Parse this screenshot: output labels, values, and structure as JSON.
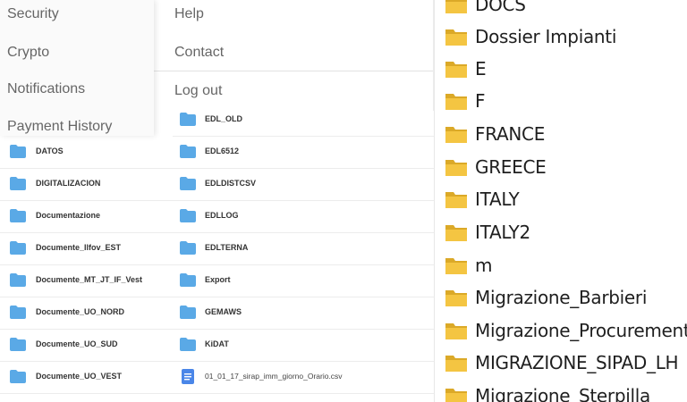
{
  "settings_menu": {
    "items": [
      "Security",
      "Crypto",
      "Notifications",
      "Payment History"
    ]
  },
  "account_menu": {
    "items": [
      "Help",
      "Contact"
    ],
    "logout": "Log out"
  },
  "folder_list_left": {
    "items": [
      "DATOS",
      "DIGITALIZACION",
      "Documentazione",
      "Documente_Ilfov_EST",
      "Documente_MT_JT_IF_Vest",
      "Documente_UO_NORD",
      "Documente_UO_SUD",
      "Documente_UO_VEST"
    ]
  },
  "folder_list_mid": {
    "items": [
      "EDL_OLD",
      "EDL6512",
      "EDLDISTCSV",
      "EDLLOG",
      "EDLTERNA",
      "Export",
      "GEMAWS",
      "KiDAT"
    ],
    "file": "01_01_17_sirap_imm_giorno_Orario.csv"
  },
  "explorer": {
    "folders": [
      "DOCS",
      "Dossier Impianti",
      "E",
      "F",
      "FRANCE",
      "GREECE",
      "ITALY",
      "ITALY2",
      "m",
      "Migrazione_Barbieri",
      "Migrazione_Procurement",
      "MIGRAZIONE_SIPAD_LH",
      "Migrazione_Sterpilla"
    ]
  },
  "colors": {
    "web_folder": "#5aa9e6",
    "file_icon": "#4a86e8",
    "explorer_folder": "#f4c542",
    "explorer_folder_dark": "#dba928",
    "menu_text": "#666666"
  },
  "icons": {
    "web_folder": "folder-icon",
    "file": "document-icon",
    "explorer_folder": "folder-icon"
  }
}
